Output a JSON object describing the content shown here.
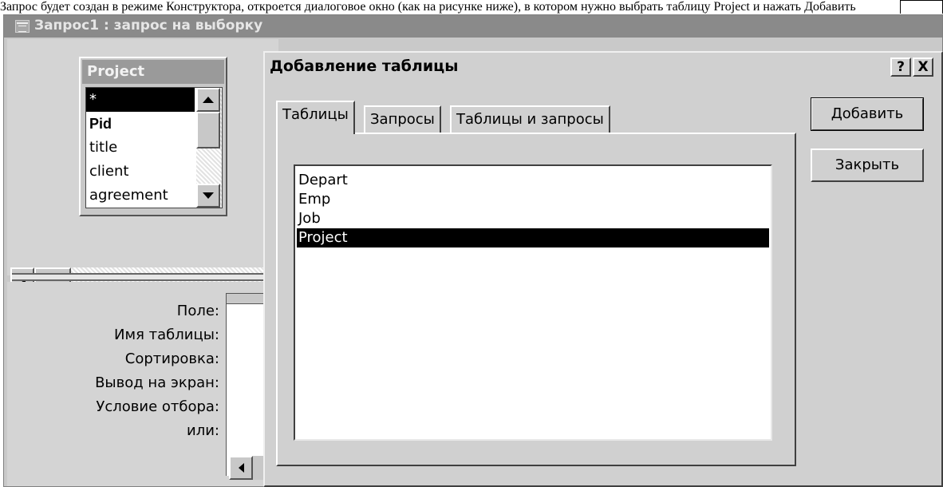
{
  "page_strip": {
    "text": "Запрос будет создан в режиме Конструктора, откроется диалоговое окно (как на рисунке ниже), в котором нужно выбрать таблицу Project и нажать Добавить"
  },
  "query_window": {
    "title": "Запрос1 : запрос на выборку",
    "field_list": {
      "title": "Project",
      "items": [
        {
          "label": "*",
          "selected": true,
          "bold": false
        },
        {
          "label": "Pid",
          "selected": false,
          "bold": true
        },
        {
          "label": "title",
          "selected": false,
          "bold": false
        },
        {
          "label": "client",
          "selected": false,
          "bold": false
        },
        {
          "label": "agreement",
          "selected": false,
          "bold": false
        }
      ]
    },
    "grid_rows": [
      "Поле:",
      "Имя таблицы:",
      "Сортировка:",
      "Вывод на экран:",
      "Условие отбора:",
      "или:"
    ]
  },
  "dialog": {
    "title": "Добавление таблицы",
    "help_label": "?",
    "close_label": "X",
    "tabs": [
      "Таблицы",
      "Запросы",
      "Таблицы и запросы"
    ],
    "active_tab": "Таблицы",
    "tables": [
      {
        "label": "Depart",
        "selected": false
      },
      {
        "label": "Emp",
        "selected": false
      },
      {
        "label": "Job",
        "selected": false
      },
      {
        "label": "Project",
        "selected": true
      }
    ],
    "add_label": "Добавить",
    "close_button_label": "Закрыть"
  }
}
